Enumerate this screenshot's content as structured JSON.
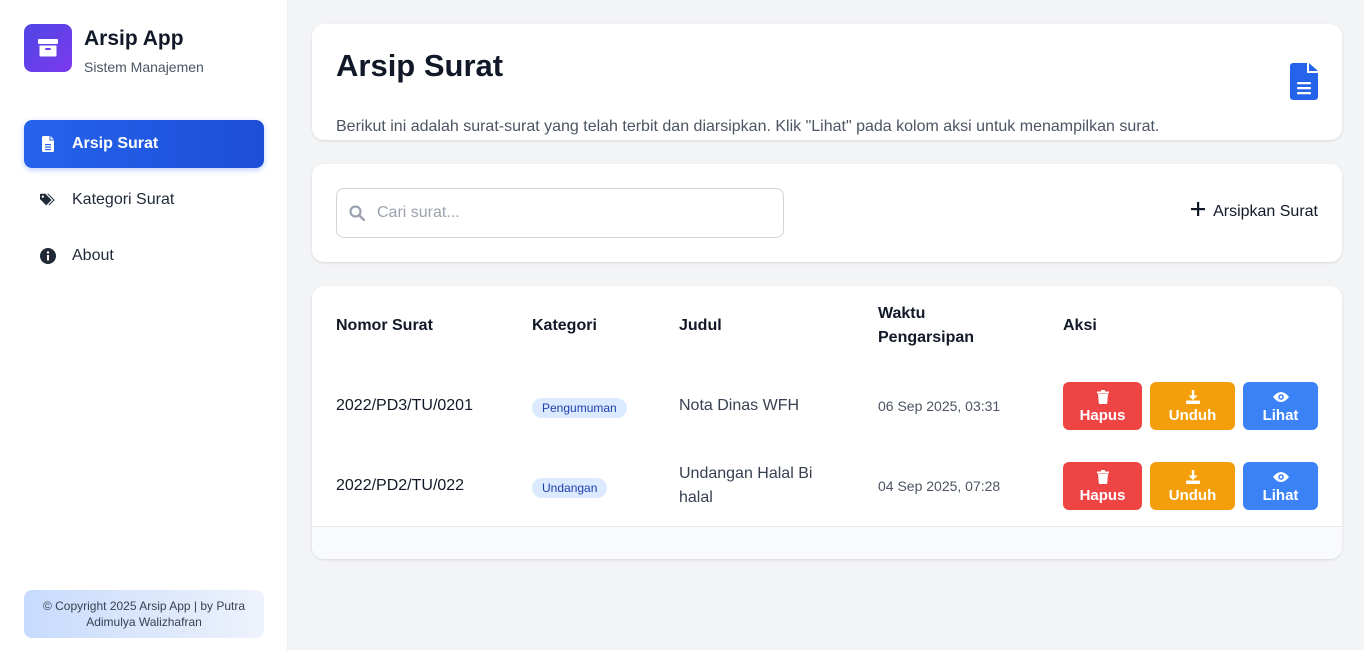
{
  "brand": {
    "title": "Arsip App",
    "subtitle": "Sistem Manajemen"
  },
  "sidebar": {
    "items": [
      {
        "label": "Arsip Surat",
        "icon": "document-icon",
        "active": true
      },
      {
        "label": "Kategori Surat",
        "icon": "tags-icon",
        "active": false
      },
      {
        "label": "About",
        "icon": "info-icon",
        "active": false
      }
    ],
    "copyright": "© Copyright 2025 Arsip App | by Putra Adimulya Walizhafran"
  },
  "header": {
    "title": "Arsip Surat",
    "description": "Berikut ini adalah surat-surat yang telah terbit dan diarsipkan. Klik \"Lihat\" pada kolom aksi untuk menampilkan surat."
  },
  "toolbar": {
    "search_placeholder": "Cari surat...",
    "add_label": "Arsipkan Surat"
  },
  "table": {
    "headers": {
      "nomor": "Nomor Surat",
      "kategori": "Kategori",
      "judul": "Judul",
      "waktu_1": "Waktu",
      "waktu_2": "Pengarsipan",
      "aksi": "Aksi"
    },
    "rows": [
      {
        "nomor": "2022/PD3/TU/0201",
        "kategori": "Pengumuman",
        "judul_1": "Nota Dinas WFH",
        "judul_2": "",
        "waktu": "06 Sep 2025, 03:31"
      },
      {
        "nomor": "2022/PD2/TU/022",
        "kategori": "Undangan",
        "judul_1": "Undangan Halal Bi",
        "judul_2": "halal",
        "waktu": "04 Sep 2025, 07:28"
      }
    ],
    "actions": {
      "hapus": "Hapus",
      "unduh": "Unduh",
      "lihat": "Lihat"
    }
  },
  "colors": {
    "primary": "#2563eb",
    "danger": "#ef4444",
    "warning": "#f59e0b",
    "info": "#3b82f6"
  }
}
